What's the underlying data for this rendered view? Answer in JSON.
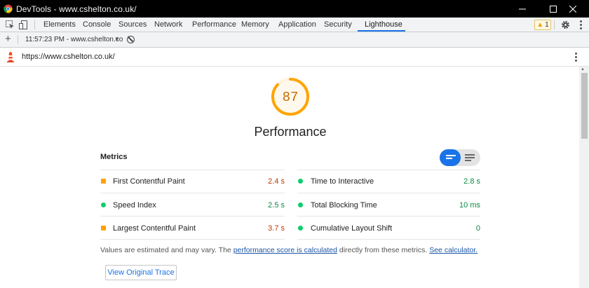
{
  "window": {
    "title": "DevTools - www.cshelton.co.uk/"
  },
  "devtools": {
    "tabs": [
      {
        "label": "Elements"
      },
      {
        "label": "Console"
      },
      {
        "label": "Sources"
      },
      {
        "label": "Network"
      },
      {
        "label": "Performance"
      },
      {
        "label": "Memory"
      },
      {
        "label": "Application"
      },
      {
        "label": "Security"
      },
      {
        "label": "Lighthouse",
        "active": true
      }
    ],
    "warnings_count": "1"
  },
  "toolbar": {
    "report_label": "11:57:23 PM - www.cshelton.co"
  },
  "url": "https://www.cshelton.co.uk/",
  "score": {
    "value": "87",
    "fraction": 0.87,
    "category": "Performance",
    "color": "#ffa400"
  },
  "metrics": {
    "title": "Metrics",
    "items": [
      {
        "label": "First Contentful Paint",
        "value": "2.4 s",
        "status": "average"
      },
      {
        "label": "Time to Interactive",
        "value": "2.8 s",
        "status": "pass"
      },
      {
        "label": "Speed Index",
        "value": "2.5 s",
        "status": "pass"
      },
      {
        "label": "Total Blocking Time",
        "value": "10 ms",
        "status": "pass"
      },
      {
        "label": "Largest Contentful Paint",
        "value": "3.7 s",
        "status": "average"
      },
      {
        "label": "Cumulative Layout Shift",
        "value": "0",
        "status": "pass"
      }
    ]
  },
  "note": {
    "prefix": "Values are estimated and may vary. The ",
    "link1": "performance score is calculated",
    "middle": " directly from these metrics. ",
    "link2": "See calculator."
  },
  "trace_button": "View Original Trace",
  "colors": {
    "accent": "#1a73e8",
    "average": "#ffa400",
    "pass": "#0cce6b"
  }
}
